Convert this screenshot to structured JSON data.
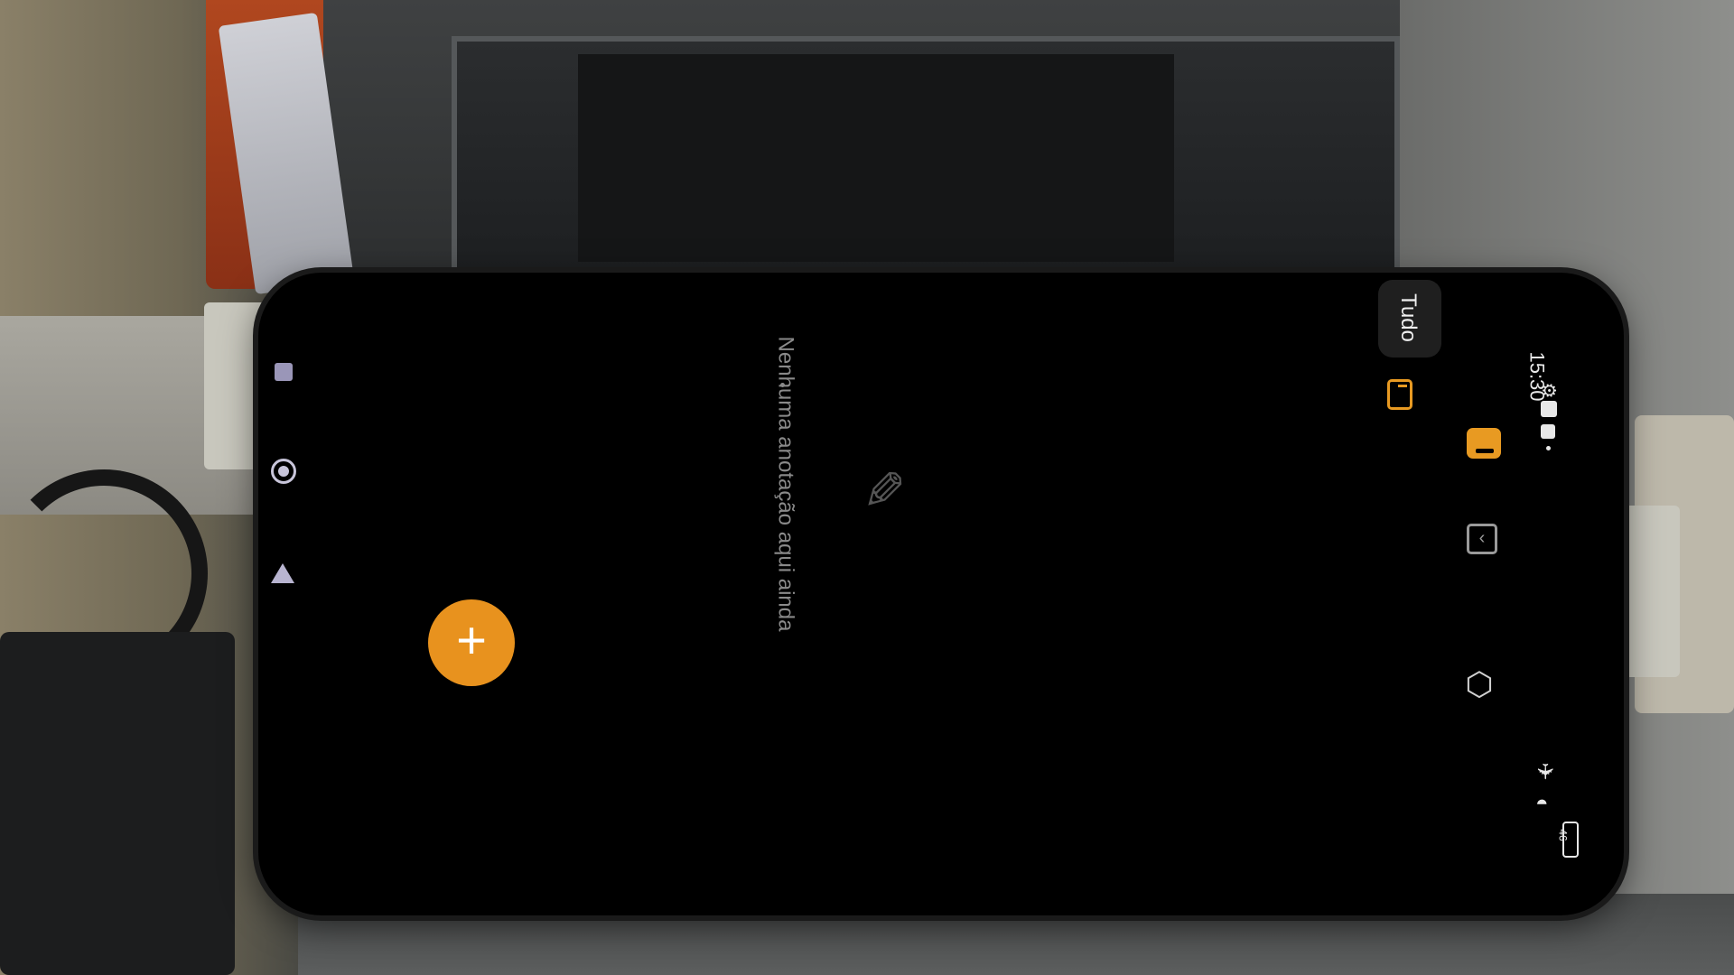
{
  "status_bar": {
    "time": "15:30",
    "battery": "46"
  },
  "filter": {
    "all_label": "Tudo"
  },
  "empty_state": {
    "message": "Nenhuma anotação aqui ainda"
  },
  "icons": {
    "settings": "settings-icon",
    "folder": "folder-icon",
    "notes_tab": "notes-tab-icon",
    "todo_tab": "todo-tab-icon",
    "fab": "add-icon"
  },
  "colors": {
    "accent": "#e8921e",
    "background": "#000000",
    "text_secondary": "#8a8a8a"
  }
}
